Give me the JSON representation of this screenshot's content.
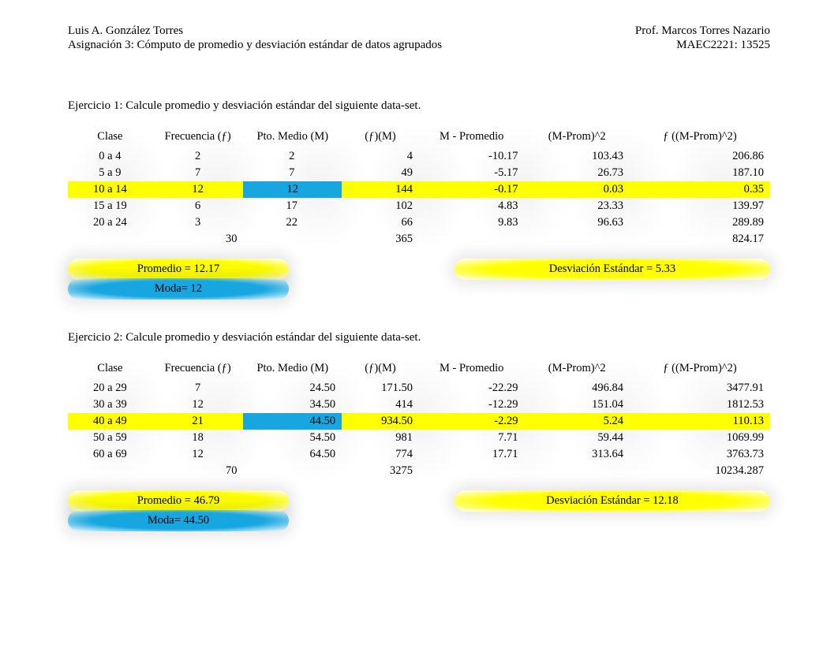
{
  "header": {
    "student": "Luis A. González Torres",
    "assignment": "Asignación 3: Cómputo de promedio y desviación estándar de datos agrupados",
    "professor": "Prof. Marcos Torres Nazario",
    "course": "MAEC2221: 13525"
  },
  "columns": {
    "clase": "Clase",
    "freq": "Frecuencia (ƒ)",
    "mid": "Pto. Medio (M)",
    "fm": "(ƒ)(M)",
    "mprom": "M - Promedio",
    "mprom2": "(M-Prom)^2",
    "fmprom2": "ƒ ((M-Prom)^2)"
  },
  "ex1": {
    "label": "Ejercicio 1: Calcule promedio y desviación estándar del siguiente data-set.",
    "rows": [
      {
        "clase": "0 a 4",
        "f": "2",
        "m": "2",
        "fm": "4",
        "mp": "-10.17",
        "mp2": "103.43",
        "fmp2": "206.86"
      },
      {
        "clase": "5 a 9",
        "f": "7",
        "m": "7",
        "fm": "49",
        "mp": "-5.17",
        "mp2": "26.73",
        "fmp2": "187.10"
      },
      {
        "clase": "10 a 14",
        "f": "12",
        "m": "12",
        "fm": "144",
        "mp": "-0.17",
        "mp2": "0.03",
        "fmp2": "0.35",
        "hl": true
      },
      {
        "clase": "15 a 19",
        "f": "6",
        "m": "17",
        "fm": "102",
        "mp": "4.83",
        "mp2": "23.33",
        "fmp2": "139.97"
      },
      {
        "clase": "20 a 24",
        "f": "3",
        "m": "22",
        "fm": "66",
        "mp": "9.83",
        "mp2": "96.63",
        "fmp2": "289.89"
      }
    ],
    "totals": {
      "f": "30",
      "fm": "365",
      "fmp2": "824.17"
    },
    "promedio": "Promedio = 12.17",
    "moda": "Moda= 12",
    "sd": "Desviación Estándar = 5.33"
  },
  "ex2": {
    "label": "Ejercicio 2: Calcule promedio y desviación estándar del siguiente data-set.",
    "rows": [
      {
        "clase": "20 a 29",
        "f": "7",
        "m": "24.50",
        "fm": "171.50",
        "mp": "-22.29",
        "mp2": "496.84",
        "fmp2": "3477.91"
      },
      {
        "clase": "30 a 39",
        "f": "12",
        "m": "34.50",
        "fm": "414",
        "mp": "-12.29",
        "mp2": "151.04",
        "fmp2": "1812.53"
      },
      {
        "clase": "40 a 49",
        "f": "21",
        "m": "44.50",
        "fm": "934.50",
        "mp": "-2.29",
        "mp2": "5.24",
        "fmp2": "110.13",
        "hl": true
      },
      {
        "clase": "50 a 59",
        "f": "18",
        "m": "54.50",
        "fm": "981",
        "mp": "7.71",
        "mp2": "59.44",
        "fmp2": "1069.99"
      },
      {
        "clase": "60 a 69",
        "f": "12",
        "m": "64.50",
        "fm": "774",
        "mp": "17.71",
        "mp2": "313.64",
        "fmp2": "3763.73"
      }
    ],
    "totals": {
      "f": "70",
      "fm": "3275",
      "fmp2": "10234.287"
    },
    "promedio": "Promedio = 46.79",
    "moda": "Moda= 44.50",
    "sd": "Desviación Estándar = 12.18"
  },
  "chart_data": [
    {
      "type": "table",
      "title": "Ejercicio 1 — grouped data",
      "columns": [
        "Clase",
        "Frecuencia (f)",
        "Pto. Medio (M)",
        "(f)(M)",
        "M - Promedio",
        "(M-Prom)^2",
        "f((M-Prom)^2)"
      ],
      "rows": [
        [
          "0 a 4",
          2,
          2,
          4,
          -10.17,
          103.43,
          206.86
        ],
        [
          "5 a 9",
          7,
          7,
          49,
          -5.17,
          26.73,
          187.1
        ],
        [
          "10 a 14",
          12,
          12,
          144,
          -0.17,
          0.03,
          0.35
        ],
        [
          "15 a 19",
          6,
          17,
          102,
          4.83,
          23.33,
          139.97
        ],
        [
          "20 a 24",
          3,
          22,
          66,
          9.83,
          96.63,
          289.89
        ]
      ],
      "totals": {
        "f": 30,
        "fm": 365,
        "f_mp2": 824.17
      },
      "stats": {
        "mean": 12.17,
        "mode": 12,
        "sd": 5.33
      }
    },
    {
      "type": "table",
      "title": "Ejercicio 2 — grouped data",
      "columns": [
        "Clase",
        "Frecuencia (f)",
        "Pto. Medio (M)",
        "(f)(M)",
        "M - Promedio",
        "(M-Prom)^2",
        "f((M-Prom)^2)"
      ],
      "rows": [
        [
          "20 a 29",
          7,
          24.5,
          171.5,
          -22.29,
          496.84,
          3477.91
        ],
        [
          "30 a 39",
          12,
          34.5,
          414,
          -12.29,
          151.04,
          1812.53
        ],
        [
          "40 a 49",
          21,
          44.5,
          934.5,
          -2.29,
          5.24,
          110.13
        ],
        [
          "50 a 59",
          18,
          54.5,
          981,
          7.71,
          59.44,
          1069.99
        ],
        [
          "60 a 69",
          12,
          64.5,
          774,
          17.71,
          313.64,
          3763.73
        ]
      ],
      "totals": {
        "f": 70,
        "fm": 3275,
        "f_mp2": 10234.287
      },
      "stats": {
        "mean": 46.79,
        "mode": 44.5,
        "sd": 12.18
      }
    }
  ]
}
